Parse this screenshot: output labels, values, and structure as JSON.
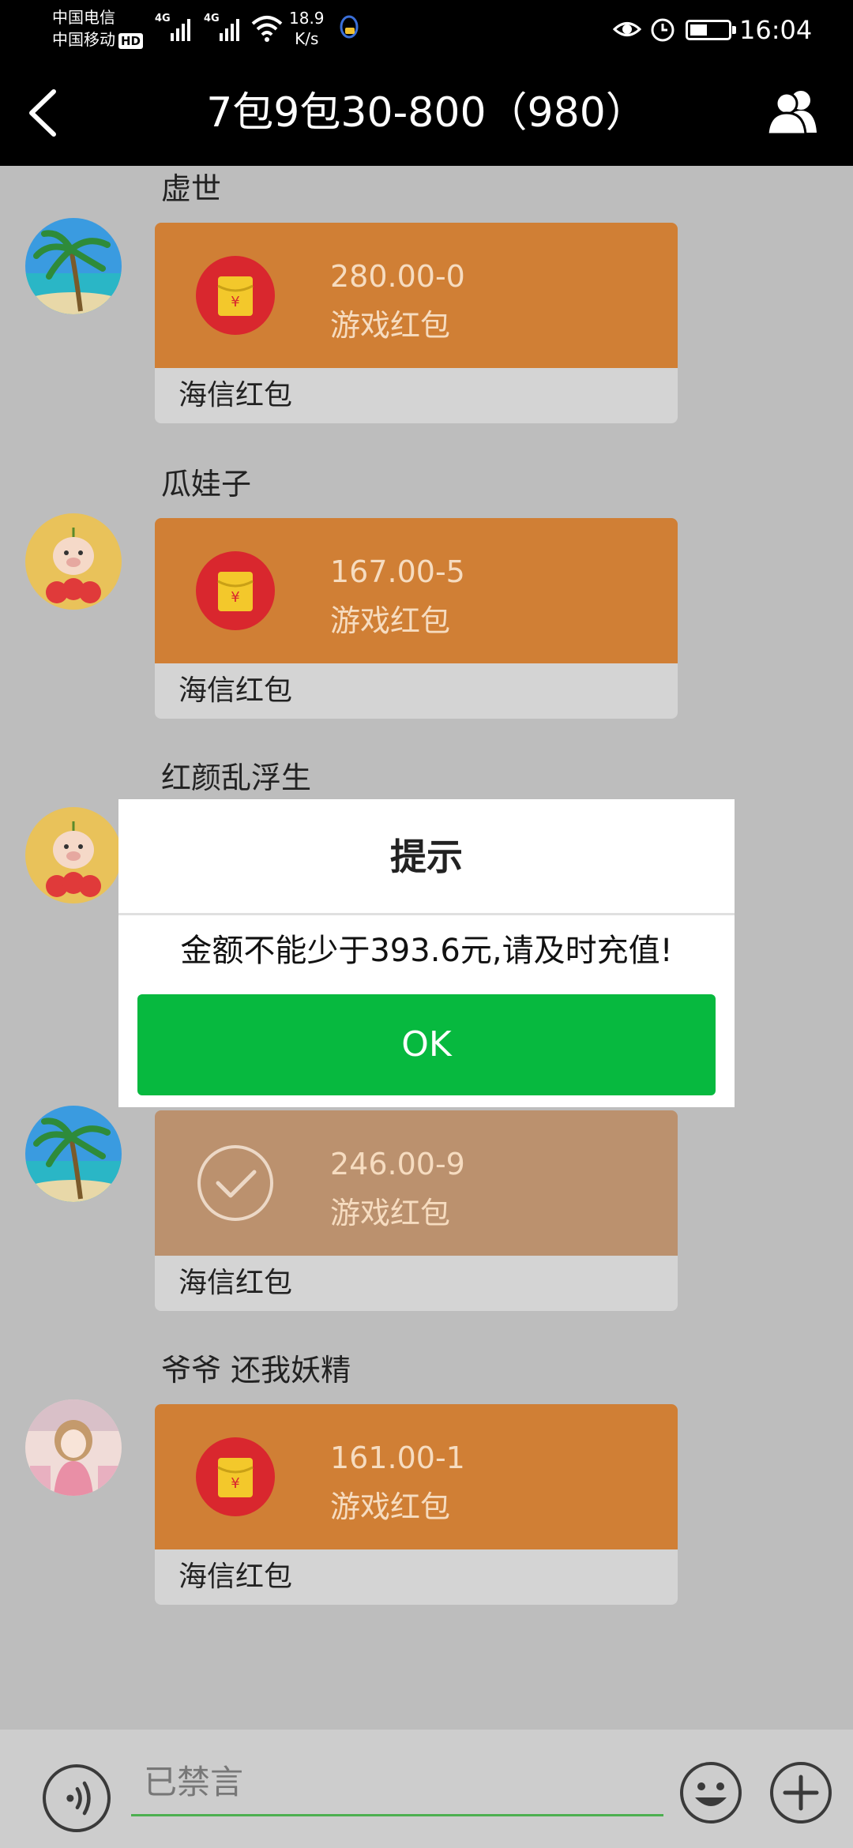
{
  "status_bar": {
    "carrier_1": "中国电信",
    "carrier_2": "中国移动",
    "hd_label": "HD",
    "network_1": "4G",
    "network_2": "4G",
    "net_speed_value": "18.9",
    "net_speed_unit": "K/s",
    "battery_level": 0.45,
    "time": "16:04"
  },
  "header": {
    "title": "7包9包30-800（980）",
    "back_icon": "chevron-left-icon",
    "group_icon": "group-members-icon"
  },
  "messages": [
    {
      "sender": "虚世",
      "amount": "280.00-0",
      "type_label": "游戏红包",
      "footer": "海信红包",
      "avatar": "beach-palm-avatar",
      "state": "unopened"
    },
    {
      "sender": "瓜娃子",
      "amount": "167.00-5",
      "type_label": "游戏红包",
      "footer": "海信红包",
      "avatar": "pig-strawberry-avatar",
      "state": "unopened"
    },
    {
      "sender": "红颜乱浮生",
      "avatar": "pig-strawberry-avatar"
    },
    {
      "amount": "246.00-9",
      "type_label": "游戏红包",
      "footer": "海信红包",
      "avatar": "beach-palm-avatar",
      "state": "opened"
    },
    {
      "sender": "爷爷 还我妖精",
      "amount": "161.00-1",
      "type_label": "游戏红包",
      "footer": "海信红包",
      "avatar": "anime-girl-avatar",
      "state": "unopened"
    }
  ],
  "dialog": {
    "title": "提示",
    "message": "金额不能少于393.6元,请及时充值!",
    "ok_label": "OK"
  },
  "input_bar": {
    "placeholder": "已禁言",
    "voice_icon": "voice-icon",
    "emoji_icon": "emoji-icon",
    "plus_icon": "plus-icon"
  },
  "colors": {
    "packet_orange": "#d07f35",
    "packet_opened": "#bb916e",
    "ok_green": "#07b93f",
    "overlay_gray": "#bdbdbd"
  }
}
